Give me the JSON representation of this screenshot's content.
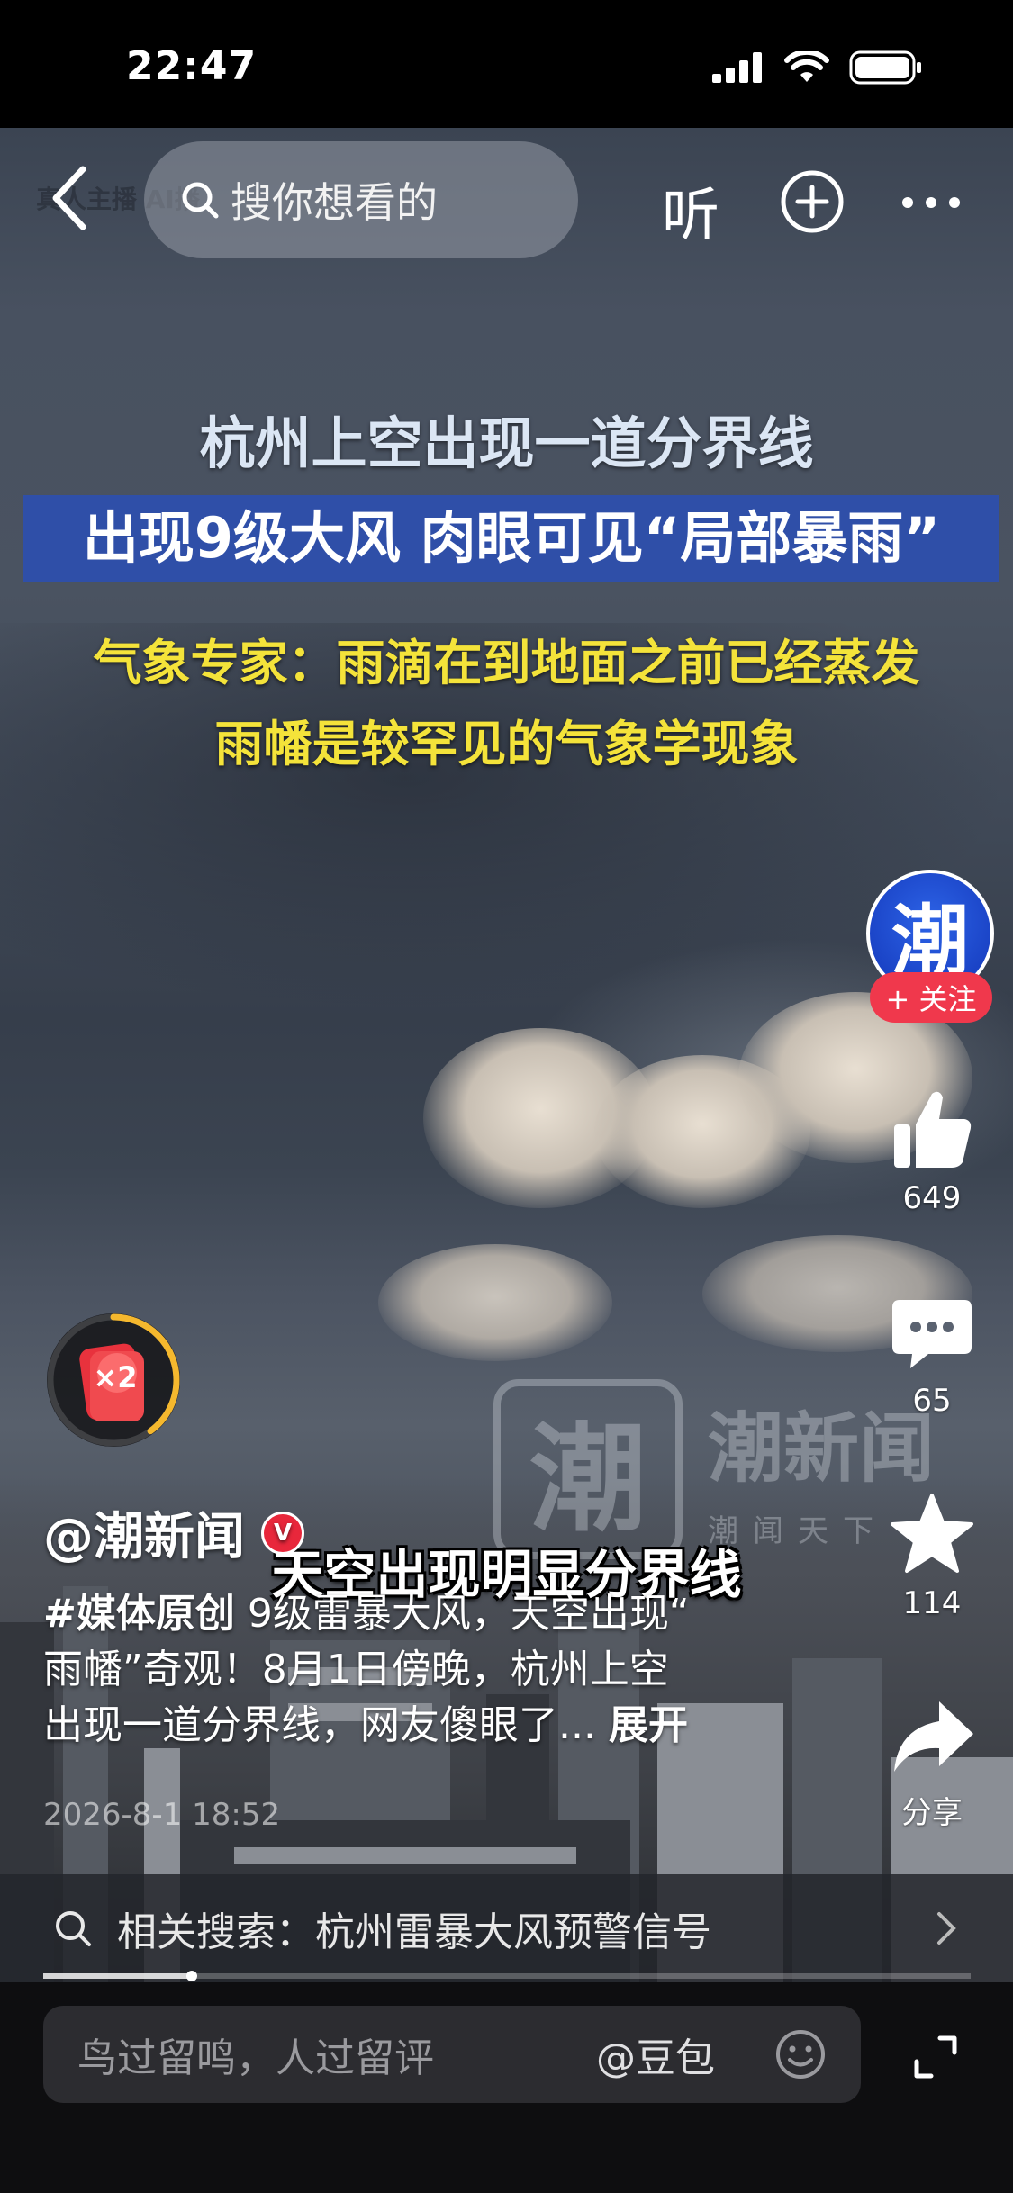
{
  "status_bar": {
    "time": "22:47"
  },
  "top_bar": {
    "ghost_text": "真人主播 AI播",
    "search_placeholder": "搜你想看的",
    "listen_label": "听"
  },
  "video": {
    "headline_1": "杭州上空出现一道分界线",
    "headline_2": "出现9级大风 肉眼可见“局部暴雨”",
    "subhead_lines": [
      "气象专家：雨滴在到地面之前已经蒸发",
      "雨幡是较罕见的气象学现象"
    ],
    "subtitle": "天空出现明显分界线",
    "watermark": {
      "glyph": "潮",
      "name": "潮新闻",
      "tag": "潮闻天下"
    }
  },
  "actions": {
    "avatar_glyph": "潮",
    "follow_label": "+ 关注",
    "like_count": "649",
    "comment_count": "65",
    "favorite_count": "114",
    "share_label": "分享"
  },
  "red_packet": {
    "multiplier": "×2",
    "progress": 0.4
  },
  "post": {
    "author": "@潮新闻",
    "verified_mark": "V",
    "desc_tag": "#媒体原创",
    "desc_lines": [
      "9级雷暴大风，天空出现“",
      "雨幡”奇观！8月1日傍晚，杭州上空",
      "出现一道分界线，网友傻眼了..."
    ],
    "expand_label": "展开",
    "time": "2026-8-1 18:52"
  },
  "related_search": {
    "text": "相关搜索：杭州雷暴大风预警信号"
  },
  "playback": {
    "progress": 0.16
  },
  "comment_bar": {
    "placeholder": "鸟过留鸣，人过留评",
    "mention": "@豆包"
  },
  "colors": {
    "follow": "#f0384c",
    "verified": "#e8273b",
    "headline_band": "#2f4fa8",
    "subhead": "#f4e33a",
    "timer_ring": "#f5b82e"
  }
}
